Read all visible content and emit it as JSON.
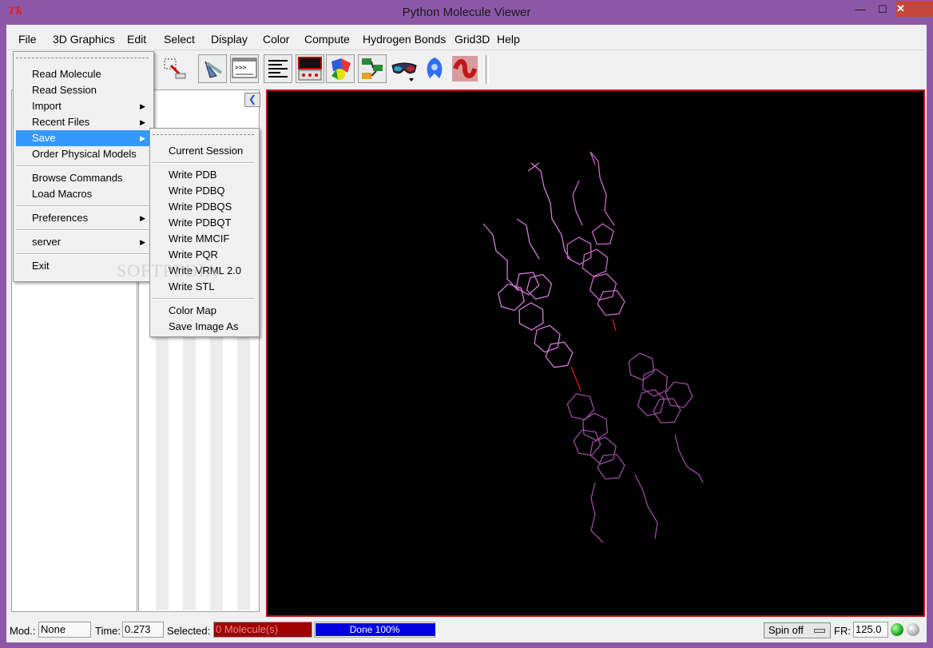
{
  "window": {
    "title": "Python Molecule Viewer",
    "icon_text": "Tk",
    "minimize": "—",
    "maximize": "☐",
    "close": "✕"
  },
  "menubar": [
    "File",
    "3D Graphics",
    "Edit",
    "Select",
    "Display",
    "Color",
    "Compute",
    "Hydrogen Bonds",
    "Grid3D",
    "Help"
  ],
  "file_menu": {
    "items": [
      {
        "label": "Read Molecule",
        "submenu": false
      },
      {
        "label": "Read Session",
        "submenu": false
      },
      {
        "label": "Import",
        "submenu": true
      },
      {
        "label": "Recent Files",
        "submenu": true
      },
      {
        "label": "Save",
        "submenu": true,
        "selected": true
      },
      {
        "label": "Order Physical Models",
        "submenu": false
      },
      {
        "label": "Browse Commands",
        "submenu": false
      },
      {
        "label": "Load Macros",
        "submenu": false
      },
      {
        "label": "Preferences",
        "submenu": true
      },
      {
        "label": "server",
        "submenu": true
      },
      {
        "label": "Exit",
        "submenu": false
      }
    ]
  },
  "save_menu": {
    "items": [
      "Current Session",
      "Write PDB",
      "Write PDBQ",
      "Write PDBQS",
      "Write PDBQT",
      "Write MMCIF",
      "Write PQR",
      "Write VRML 2.0",
      "Write STL",
      "Color Map",
      "Save Image As"
    ]
  },
  "toolbar": {
    "icons": [
      "select-box-icon",
      "hand-tool-icon",
      "python-shell-icon",
      "text-align-icon",
      "dashboard-icon",
      "color-shapes-icon",
      "network-icon",
      "stereo-glasses-icon",
      "surface-blob-icon",
      "protein-ribbon-icon"
    ]
  },
  "watermark": "SOFTPEDIA",
  "statusbar": {
    "mod_label": "Mod.:",
    "mod_value": "None",
    "time_label": "Time:",
    "time_value": "0.273",
    "selected_label": "Selected:",
    "selected_value": "0 Molecule(s)",
    "progress_text": "Done 100%",
    "progress": 1.0,
    "spin_label": "Spin off",
    "fr_label": "FR:",
    "fr_value": "125.0"
  },
  "colors": {
    "frame": "#8e58a8",
    "selection": "#3399ff",
    "molecule": "#c870d0",
    "selected_box": "#a00000",
    "progress": "#0000e0"
  }
}
